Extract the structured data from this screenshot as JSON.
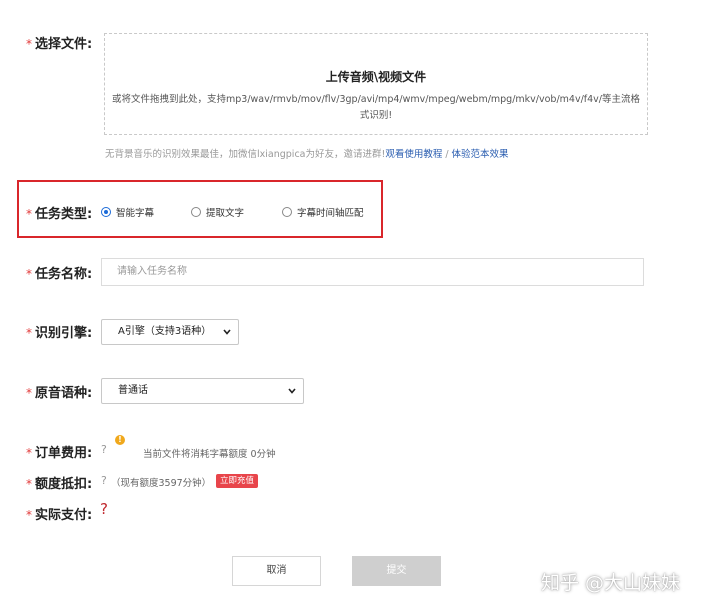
{
  "required_mark": "*",
  "file": {
    "label": "选择文件:",
    "upload_title": "上传音频\\视频文件",
    "upload_desc": "或将文件拖拽到此处，支持mp3/wav/rmvb/mov/flv/3gp/avi/mp4/wmv/mpeg/webm/mpg/mkv/vob/m4v/f4v/等主流格式识别!",
    "hint_text": "无背景音乐的识别效果最佳，加微信lxiangpica为好友，邀请进群!",
    "hint_link1": "观看使用教程",
    "hint_sep": "/",
    "hint_link2": "体验范本效果"
  },
  "task_type": {
    "label": "任务类型:",
    "options": [
      {
        "label": "智能字幕",
        "checked": true
      },
      {
        "label": "提取文字",
        "checked": false
      },
      {
        "label": "字幕时间轴匹配",
        "checked": false
      }
    ]
  },
  "task_name": {
    "label": "任务名称:",
    "placeholder": "请输入任务名称",
    "value": ""
  },
  "engine": {
    "label": "识别引擎:",
    "selected": "A引擎（支持3语种）"
  },
  "language": {
    "label": "原音语种:",
    "selected": "普通话"
  },
  "order_fee": {
    "label": "订单费用:",
    "question": "?",
    "info_icon": "!",
    "note": "当前文件将消耗字幕额度 0分钟"
  },
  "deduct": {
    "label": "额度抵扣:",
    "question": "?",
    "note": "（现有额度3597分钟）",
    "recharge": "立即充值"
  },
  "actual_pay": {
    "label": "实际支付:",
    "value": "?"
  },
  "buttons": {
    "cancel": "取消",
    "submit": "提交"
  },
  "watermark": "知乎 @大山妹妹",
  "colors": {
    "required": "#e23b3b",
    "link": "#2a5db0",
    "highlight_box": "#d9262b",
    "radio_checked": "#1c6bd8",
    "recharge_badge": "#e8454b",
    "info_icon": "#f0a81c"
  }
}
